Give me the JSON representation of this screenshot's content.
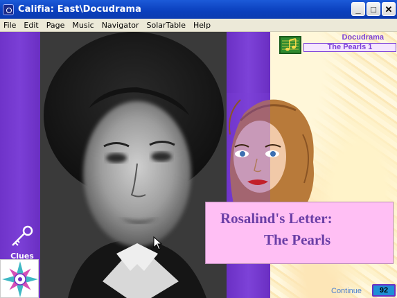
{
  "window": {
    "title": "Califia:  East\\Docudrama",
    "minimize": "_",
    "maximize": "□",
    "close": "✕"
  },
  "menu": {
    "items": [
      {
        "label": "File"
      },
      {
        "label": "Edit"
      },
      {
        "label": "Page"
      },
      {
        "label": "Music"
      },
      {
        "label": "Navigator"
      },
      {
        "label": "SolarTable"
      },
      {
        "label": "Help"
      }
    ]
  },
  "header": {
    "section": "Docudrama",
    "page": "The Pearls 1",
    "music_icon": "music-note-icon"
  },
  "sidebar": {
    "clues_label": "Clues",
    "clues_icon": "key-icon",
    "compass_icon": "compass-rose-icon"
  },
  "letter": {
    "line1": "Rosalind's Letter:",
    "line2": "The Pearls"
  },
  "footer": {
    "continue_label": "Continue",
    "page_number": "92"
  },
  "colors": {
    "purple": "#7b3fd6",
    "letter_bg": "#ffbff4",
    "letter_text": "#6a3ea6",
    "titlebar": "#0a3fbd"
  }
}
